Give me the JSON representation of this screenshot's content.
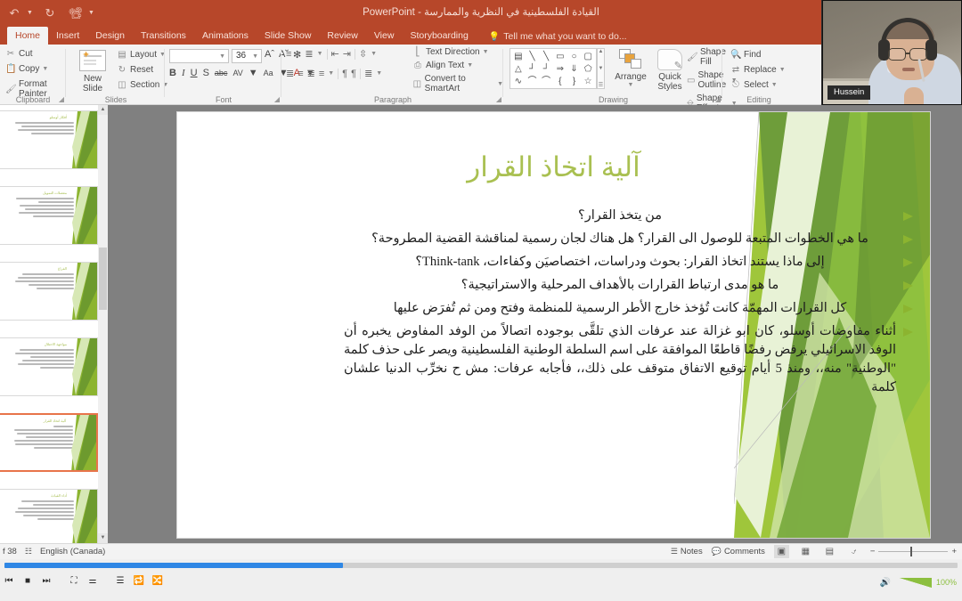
{
  "window": {
    "title": "القيادة الفلسطينية في النظرية والممارسة  -  PowerPoint",
    "quick_access": [
      "undo-icon",
      "redo-icon",
      "start-slideshow-icon",
      "customize-qat-icon"
    ]
  },
  "ribbon": {
    "tabs": [
      {
        "label": "Home",
        "active": true
      },
      {
        "label": "Insert",
        "active": false
      },
      {
        "label": "Design",
        "active": false
      },
      {
        "label": "Transitions",
        "active": false
      },
      {
        "label": "Animations",
        "active": false
      },
      {
        "label": "Slide Show",
        "active": false
      },
      {
        "label": "Review",
        "active": false
      },
      {
        "label": "View",
        "active": false
      },
      {
        "label": "Storyboarding",
        "active": false
      }
    ],
    "tell_me": "Tell me what you want to do...",
    "groups": {
      "clipboard": {
        "label": "Clipboard",
        "items": [
          {
            "label": "Cut",
            "icon": "scissors-icon"
          },
          {
            "label": "Copy",
            "icon": "copy-icon"
          },
          {
            "label": "Format Painter",
            "icon": "paintbrush-icon"
          }
        ]
      },
      "slides": {
        "label": "Slides",
        "new_slide": "New\nSlide",
        "new_slide_line1": "New",
        "new_slide_line2": "Slide",
        "items": [
          {
            "label": "Layout",
            "icon": "layout-icon"
          },
          {
            "label": "Reset",
            "icon": "reset-icon"
          },
          {
            "label": "Section",
            "icon": "section-icon"
          }
        ]
      },
      "font": {
        "label": "Font",
        "font_name": "",
        "font_name_placeholder": "",
        "font_size": "36",
        "buttons": [
          "B",
          "I",
          "U",
          "S",
          "abc",
          "AV",
          "Aa",
          "A"
        ]
      },
      "paragraph": {
        "label": "Paragraph",
        "items": [
          {
            "label": "Text Direction",
            "icon": "text-direction-icon"
          },
          {
            "label": "Align Text",
            "icon": "align-text-icon"
          },
          {
            "label": "Convert to SmartArt",
            "icon": "smartart-icon"
          }
        ]
      },
      "drawing": {
        "label": "Drawing",
        "arrange": "Arrange",
        "quick_styles_line1": "Quick",
        "quick_styles_line2": "Styles",
        "items": [
          {
            "label": "Shape Fill",
            "icon": "shape-fill-icon"
          },
          {
            "label": "Shape Outline",
            "icon": "shape-outline-icon"
          },
          {
            "label": "Shape Effects",
            "icon": "shape-effects-icon"
          }
        ],
        "shapes": [
          "A",
          "\\",
          "\\",
          "▭",
          "◯",
          "▢",
          "△",
          "⌐",
          "⌐",
          "⇨",
          "⇩",
          "◠",
          "↯",
          "⌒",
          "⌒",
          "{",
          "}",
          "☆"
        ]
      },
      "editing": {
        "label": "Editing",
        "items": [
          {
            "label": "Find",
            "icon": "search-icon"
          },
          {
            "label": "Replace",
            "icon": "replace-icon"
          },
          {
            "label": "Select",
            "icon": "cursor-select-icon"
          }
        ]
      }
    }
  },
  "thumbnails": [
    {
      "title": "أفكار أوسلو",
      "lines": 4,
      "selected": false
    },
    {
      "title": "معضلات التمويل",
      "lines": 6,
      "selected": false
    },
    {
      "title": "الفراغ",
      "lines": 5,
      "selected": false
    },
    {
      "title": "مواجهة الاحتلال",
      "lines": 6,
      "selected": false
    },
    {
      "title": "آلية اتخاذ القرار",
      "lines": 7,
      "selected": true
    },
    {
      "title": "أداء القيادة",
      "lines": 6,
      "selected": false
    }
  ],
  "slide": {
    "title": "آلية اتخاذ القرار",
    "bullets": [
      {
        "text": "من يتخذ القرار؟",
        "align": "center"
      },
      {
        "text": "ما هي الخطوات المتبعة للوصول الى القرار؟ هل هناك لجان رسمية لمناقشة القضية المطروحة؟",
        "align": "center"
      },
      {
        "text": "إلى ماذا يستند اتخاذ القرار: بحوث ودراسات، اختصاصيَن وكفاءات،  Think-tank؟",
        "align": "center"
      },
      {
        "text": "ما هو مدى ارتباط القرارات بالأهداف المرحلية والاستراتيجية؟",
        "align": "center"
      },
      {
        "text": "كل القرارات المهمّة كانت تُؤخذ خارج الأطر الرسمية للمنظمة وفتح ومن ثم تُفرَض عليها",
        "align": "center"
      },
      {
        "text": "أثناء مفاوضات أوسلو، كان ابو غزالة عند عرفات الذي تلقَّى بوجوده اتصالاً من الوفد المفاوض يخبره أن الوفد الاسرائيلي يرفض رفضًا قاطعًا الموافقة على اسم السلطة الوطنية الفلسطينية ويصر على حذف كلمة \"الوطنية\" منه،، ومنذ 5 أيام توقيع الاتفاق متوقف على ذلك،، فأجابه عرفات: مش ح نخرِّب الدنيا علشان كلمة",
        "align": "justify"
      }
    ],
    "accent_color": "#a9c051",
    "bullet_color": "#8cb430"
  },
  "status_bar": {
    "slide_counter": "f 38",
    "language": "English (Canada)",
    "notes": "Notes",
    "comments": "Comments",
    "zoom_level": "",
    "view_buttons": [
      "normal-view-icon",
      "slide-sorter-icon",
      "reading-view-icon",
      "slideshow-icon"
    ],
    "zoom_minus": "−",
    "zoom_plus": "+"
  },
  "player": {
    "buttons": [
      "previous-icon",
      "stop-icon",
      "next-icon",
      "fullscreen-icon",
      "equalizer-icon",
      "playlist-icon",
      "loop-icon",
      "shuffle-icon"
    ],
    "volume_percent": "100%",
    "volume_icon": "speaker-icon",
    "progress_percent": 35
  },
  "webcam": {
    "participant_name": "Hussein"
  }
}
